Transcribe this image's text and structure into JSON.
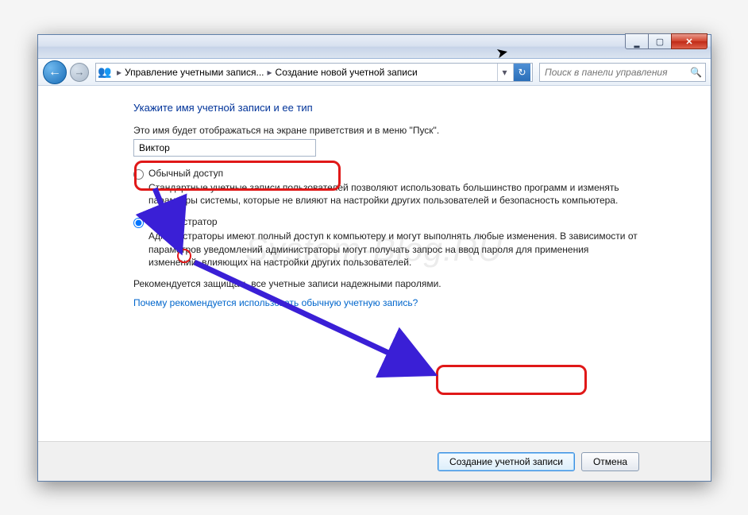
{
  "titlebar": {
    "min_label": "Minimize",
    "max_label": "Maximize",
    "close_label": "Close"
  },
  "nav": {
    "back_label": "Back",
    "forward_label": "Forward"
  },
  "breadcrumb": {
    "root": "Управление учетными запися...",
    "current": "Создание новой учетной записи",
    "refresh_label": "Refresh"
  },
  "search": {
    "placeholder": "Поиск в панели управления"
  },
  "main": {
    "heading": "Укажите имя учетной записи и ее тип",
    "intro": "Это имя будет отображаться на экране приветствия и в меню \"Пуск\".",
    "account_name": "Виктор",
    "options": [
      {
        "id": "standard",
        "label": "Обычный доступ",
        "checked": false,
        "desc": "Стандартные учетные записи пользователей позволяют использовать большинство программ и изменять параметры системы, которые не влияют на настройки других пользователей и безопасность компьютера."
      },
      {
        "id": "admin",
        "label": "Администратор",
        "checked": true,
        "desc": "Администраторы имеют полный доступ к компьютеру и могут выполнять любые изменения. В зависимости от параметров уведомлений администраторы могут получать запрос на ввод пароля для применения изменений, влияющих на настройки других пользователей."
      }
    ],
    "recommend": "Рекомендуется защищать все учетные записи надежными паролями.",
    "link": "Почему рекомендуется использовать обычную учетную запись?"
  },
  "buttons": {
    "create": "Создание учетной записи",
    "cancel": "Отмена"
  },
  "watermark": "System-Blog.RU"
}
